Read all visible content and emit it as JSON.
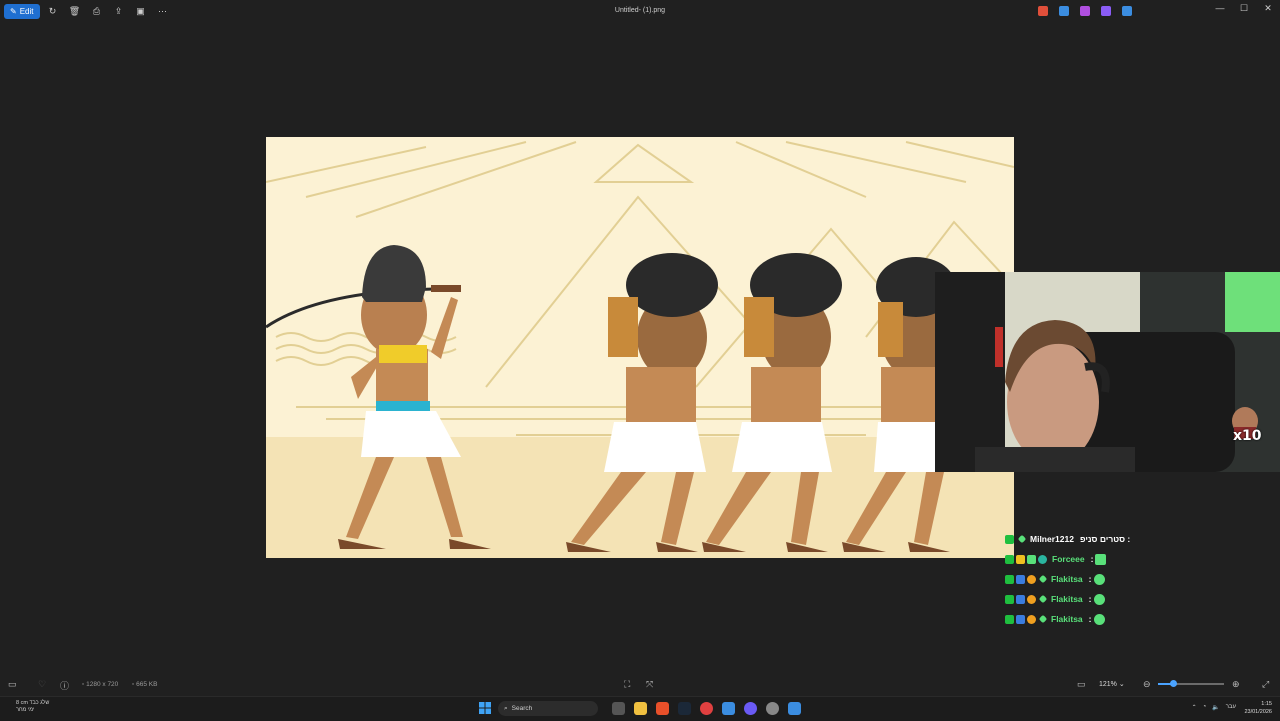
{
  "window": {
    "title": "Untitled- (1).png",
    "edit_label": "Edit",
    "controls": [
      "minimize-icon",
      "maximize-icon",
      "close-icon"
    ]
  },
  "toolbar": {
    "icons": [
      "rotate-icon",
      "delete-icon",
      "print-icon",
      "share-icon",
      "slideshow-icon",
      "more-icon"
    ],
    "extensions": [
      {
        "name": "colorful-app-icon",
        "color": "#e04f3a"
      },
      {
        "name": "pen-icon",
        "color": "#3b8de0"
      },
      {
        "name": "copilot-icon",
        "color": "#b04fe0"
      },
      {
        "name": "gallery-icon",
        "color": "#8a5cf5"
      },
      {
        "name": "onedrive-icon",
        "color": "#3b8de0"
      }
    ]
  },
  "chat": {
    "lines": [
      {
        "user": "Milner1212",
        "message": "סטרים סניפ :",
        "user_color": "#ffffff"
      },
      {
        "user": "Forceee",
        "message": ":",
        "user_color": "#59e07a"
      },
      {
        "user": "Flakitsa",
        "message": ":",
        "user_color": "#59e07a"
      },
      {
        "user": "Flakitsa",
        "message": ":",
        "user_color": "#59e07a"
      },
      {
        "user": "Flakitsa",
        "message": ":",
        "user_color": "#59e07a"
      }
    ],
    "emote_count": "x10"
  },
  "statusbar": {
    "dimensions": "1280 x 720",
    "size": "665 KB",
    "zoom": "121%",
    "zoom_fraction": 0.22
  },
  "taskbar": {
    "weather_line1": "8 cm שלג כבד",
    "weather_line2": "ימי מחר",
    "search_placeholder": "Search",
    "time": "1:15",
    "date": "23/01/2026",
    "lang": "עבר"
  },
  "colors": {
    "accent": "#1f6fd1",
    "canvas_bg": "#fcf2d4",
    "sand": "#f4e3b5",
    "skin": "#c48a55",
    "kilt": "#ffffff"
  }
}
